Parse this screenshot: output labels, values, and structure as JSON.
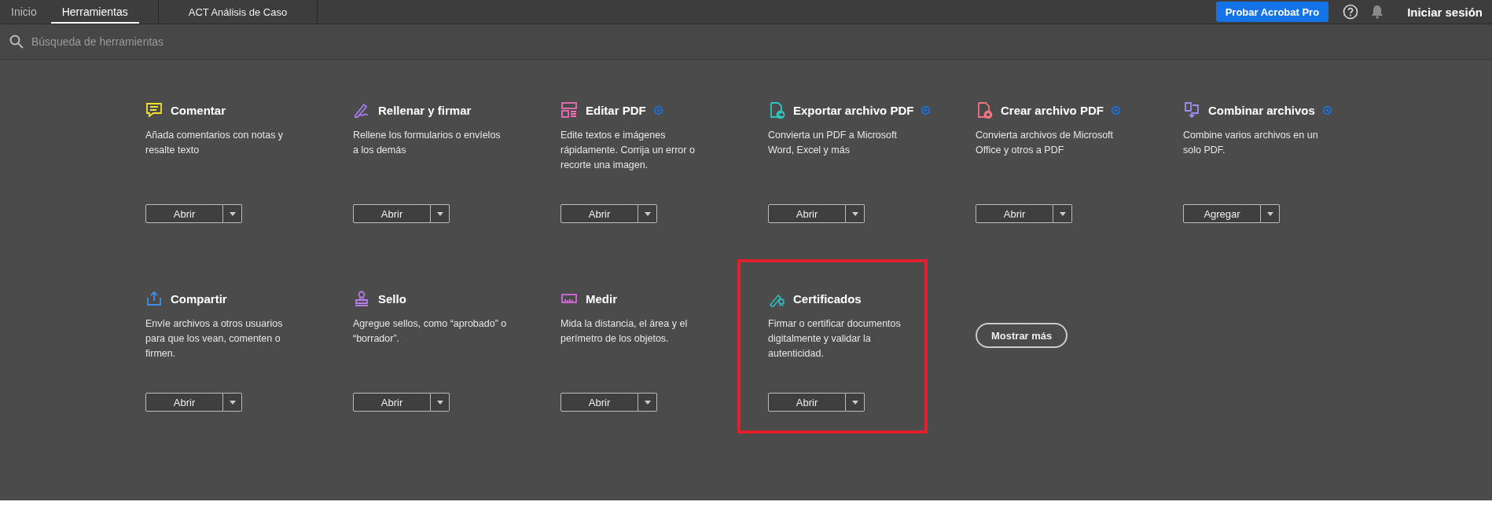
{
  "top_bar": {
    "tabs": [
      {
        "label": "Inicio",
        "selected": false
      },
      {
        "label": "Herramientas",
        "selected": true
      }
    ],
    "document_tab": "ACT Análisis de Caso",
    "try_button": "Probar Acrobat Pro",
    "sign_in": "Iniciar sesión"
  },
  "search": {
    "placeholder": "Búsqueda de herramientas"
  },
  "tools": [
    {
      "title": "Comentar",
      "description": "Añada comentarios con notas y resalte texto",
      "premium": false,
      "button": "Abrir",
      "highlighted": false
    },
    {
      "title": "Rellenar y firmar",
      "description": "Rellene los formularios o envíelos a los demás",
      "premium": false,
      "button": "Abrir",
      "highlighted": false
    },
    {
      "title": "Editar PDF",
      "description": "Edite textos e imágenes rápidamente. Corrija un error o recorte una imagen.",
      "premium": true,
      "button": "Abrir",
      "highlighted": false
    },
    {
      "title": "Exportar archivo PDF",
      "description": "Convierta un PDF a Microsoft Word, Excel y más",
      "premium": true,
      "button": "Abrir",
      "highlighted": false
    },
    {
      "title": "Crear archivo PDF",
      "description": "Convierta archivos de Microsoft Office y otros a PDF",
      "premium": true,
      "button": "Abrir",
      "highlighted": false
    },
    {
      "title": "Combinar archivos",
      "description": "Combine varios archivos en un solo PDF.",
      "premium": true,
      "button": "Agregar",
      "highlighted": false
    },
    {
      "title": "Compartir",
      "description": "Envíe archivos a otros usuarios para que los vean, comenten o firmen.",
      "premium": false,
      "button": "Abrir",
      "highlighted": false
    },
    {
      "title": "Sello",
      "description": "Agregue sellos, como “aprobado” o “borrador”.",
      "premium": false,
      "button": "Abrir",
      "highlighted": false
    },
    {
      "title": "Medir",
      "description": "Mida la distancia, el área y el perímetro de los objetos.",
      "premium": false,
      "button": "Abrir",
      "highlighted": false
    },
    {
      "title": "Certificados",
      "description": "Firmar o certificar documentos digitalmente y validar la autenticidad.",
      "premium": false,
      "button": "Abrir",
      "highlighted": true
    }
  ],
  "show_more_button": "Mostrar más"
}
